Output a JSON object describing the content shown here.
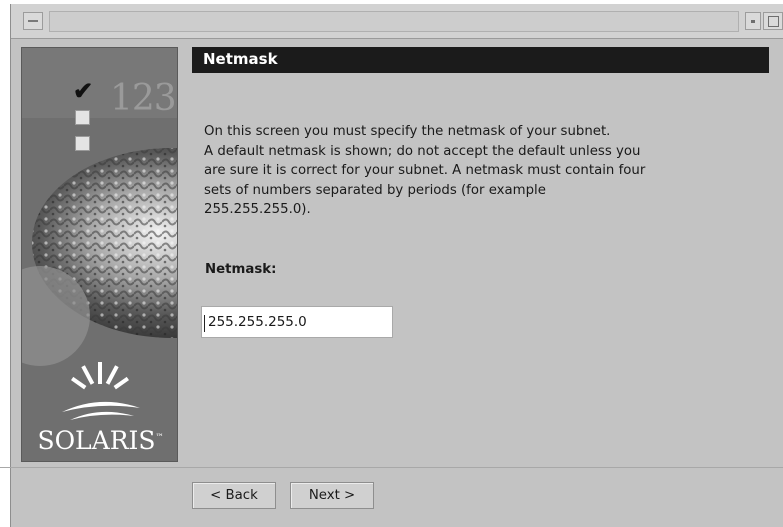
{
  "window": {
    "menu_icon": "window-menu-icon",
    "minimize_icon": "window-minimize-icon",
    "maximize_icon": "window-maximize-icon"
  },
  "side_panel": {
    "step_numbers": "123",
    "brand": "SOLARIS",
    "trademark": "™",
    "check_icon": "checkmark-icon",
    "logo_icon": "sun-rays-logo-icon"
  },
  "header": {
    "title": "Netmask"
  },
  "description": {
    "lines": [
      "On this screen you must specify the netmask of your subnet.",
      "A default netmask is shown; do not accept the default unless you",
      "are sure it is correct for your subnet. A netmask must contain four",
      "sets of numbers separated by periods (for example",
      "255.255.255.0)."
    ]
  },
  "netmask_field": {
    "label": "Netmask:",
    "value": "255.255.255.0"
  },
  "buttons": {
    "back": "< Back",
    "next": "Next >"
  },
  "colors": {
    "window_bg": "#c3c3c3",
    "header_bg": "#1b1b1b",
    "side_panel_bg": "#6f6f6f"
  }
}
